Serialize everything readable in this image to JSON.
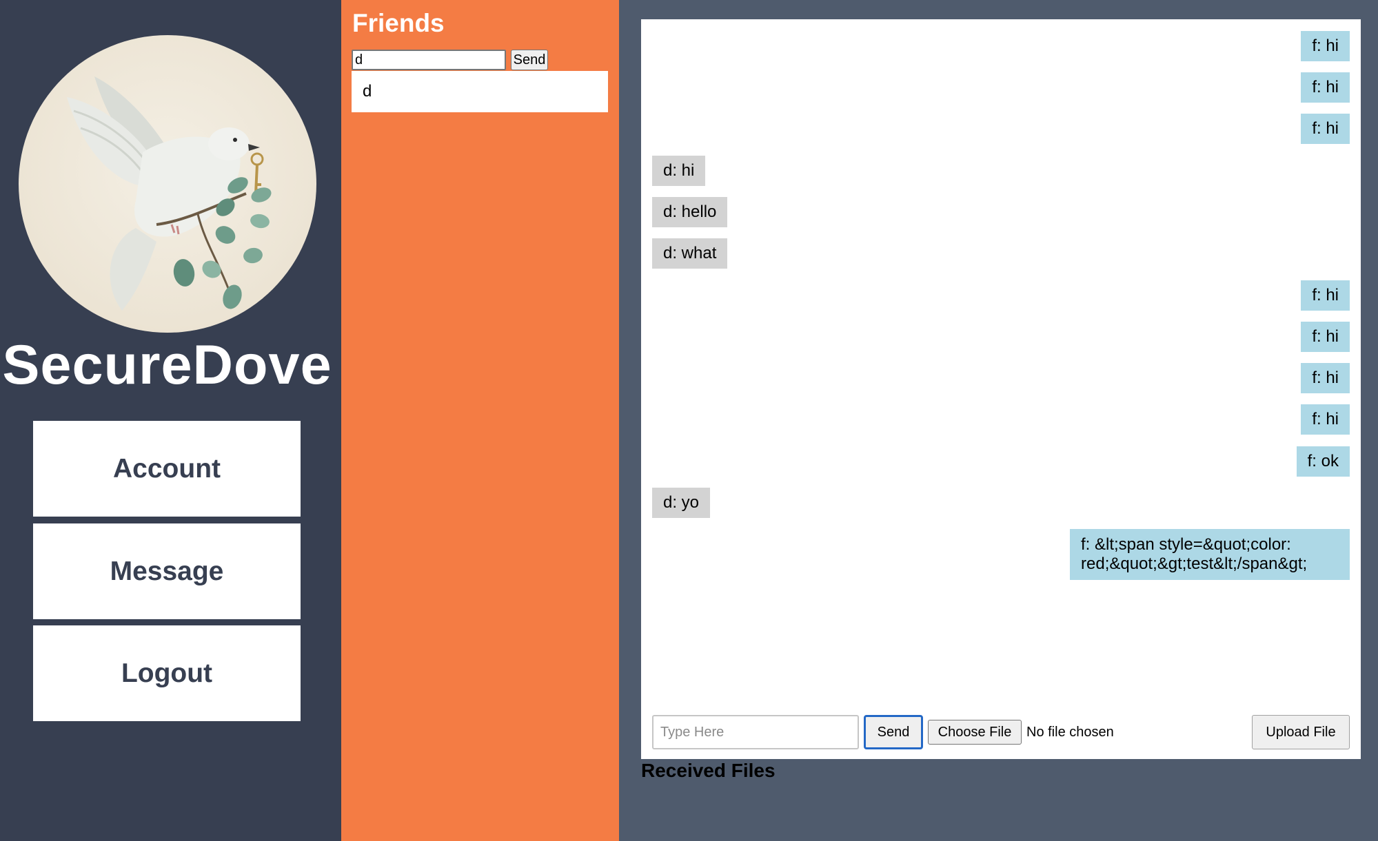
{
  "sidebar": {
    "brand": "SecureDove",
    "nav": [
      {
        "label": "Account"
      },
      {
        "label": "Message"
      },
      {
        "label": "Logout"
      }
    ]
  },
  "friends": {
    "title": "Friends",
    "input_value": "d",
    "send_label": "Send",
    "items": [
      {
        "name": "d"
      }
    ]
  },
  "chat": {
    "messages": [
      {
        "from": "f",
        "text": "f: hi"
      },
      {
        "from": "f",
        "text": "f: hi"
      },
      {
        "from": "f",
        "text": "f: hi"
      },
      {
        "from": "d",
        "text": "d: hi"
      },
      {
        "from": "d",
        "text": "d: hello"
      },
      {
        "from": "d",
        "text": "d: what"
      },
      {
        "from": "f",
        "text": "f: hi"
      },
      {
        "from": "f",
        "text": "f: hi"
      },
      {
        "from": "f",
        "text": "f: hi"
      },
      {
        "from": "f",
        "text": "f: hi"
      },
      {
        "from": "f",
        "text": "f: ok"
      },
      {
        "from": "d",
        "text": "d: yo"
      },
      {
        "from": "f",
        "text": "f: &lt;span style=&quot;color: red;&quot;&gt;test&lt;/span&gt;"
      }
    ],
    "input_placeholder": "Type Here",
    "send_label": "Send",
    "choose_file_label": "Choose File",
    "no_file_text": "No file chosen",
    "upload_label": "Upload File"
  },
  "received_files": {
    "title": "Received Files"
  },
  "colors": {
    "sidebar_bg": "#373f51",
    "friends_bg": "#f47c44",
    "chat_area_bg": "#4f5b6d",
    "mine_bubble": "#add8e6",
    "theirs_bubble": "#d3d3d3"
  },
  "icons": {
    "logo": "dove-with-key-logo"
  }
}
